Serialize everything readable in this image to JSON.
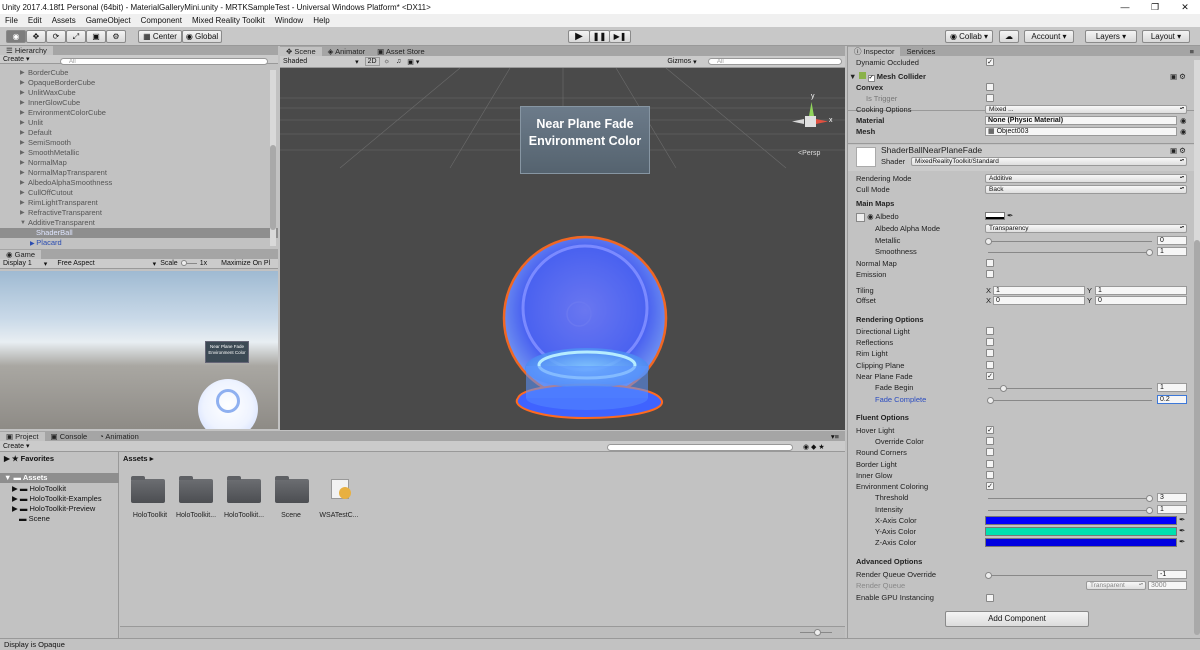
{
  "window_title": "Unity 2017.4.18f1 Personal (64bit) - MaterialGalleryMini.unity - MRTKSampleTest - Universal Windows Platform* <DX11>",
  "menu": [
    "File",
    "Edit",
    "Assets",
    "GameObject",
    "Component",
    "Mixed Reality Toolkit",
    "Window",
    "Help"
  ],
  "toolbar": {
    "center": "Center",
    "global": "Global",
    "collab": "Collab",
    "account": "Account",
    "layers": "Layers",
    "layout": "Layout"
  },
  "hierarchy": {
    "tab": "Hierarchy",
    "create": "Create",
    "search_placeholder": "All",
    "items": [
      "BorderCube",
      "OpaqueBorderCube",
      "UnlitWaxCube",
      "InnerGlowCube",
      "EnvironmentColorCube",
      "Unlit",
      "Default",
      "SemiSmooth",
      "SmoothMetallic",
      "NormalMap",
      "NormalMapTransparent",
      "AlbedoAlphaSmoothness",
      "CullOffCutout",
      "RimLightTransparent",
      "RefractiveTransparent",
      "AdditiveTransparent"
    ],
    "selected": "ShaderBall",
    "next": "Placard"
  },
  "game": {
    "tab": "Game",
    "display": "Display 1",
    "aspect": "Free Aspect",
    "scale_label": "Scale",
    "scale_value": "1x",
    "maximize": "Maximize On Pl",
    "placard": "Near Plane Fade Environment Color"
  },
  "scene": {
    "tab": "Scene",
    "animator": "Animator",
    "asset_store": "Asset Store",
    "shading": "Shaded",
    "mode_2d": "2D",
    "gizmos": "Gizmos",
    "search_placeholder": "All",
    "persp": "Persp",
    "placard": "Near Plane Fade Environment Color",
    "axis_x": "x",
    "axis_y": "y"
  },
  "project": {
    "tab": "Project",
    "console": "Console",
    "animation": "Animation",
    "create": "Create",
    "favorites": "Favorites",
    "assets_root": "Assets",
    "tree": [
      "HoloToolkit",
      "HoloToolkit-Examples",
      "HoloToolkit-Preview",
      "Scene"
    ],
    "breadcrumb": "Assets",
    "items": [
      "HoloToolkit",
      "HoloToolkit...",
      "HoloToolkit...",
      "Scene",
      "WSATestC..."
    ]
  },
  "status": "Display is Opaque",
  "inspector": {
    "tab": "Inspector",
    "services": "Services",
    "dynamic_occluded": "Dynamic Occluded",
    "mesh_collider": "Mesh Collider",
    "convex": "Convex",
    "is_trigger": "Is Trigger",
    "cooking_label": "Cooking Options",
    "cooking_value": "Mixed ...",
    "material_label": "Material",
    "material_value": "None (Physic Material)",
    "mesh_label": "Mesh",
    "mesh_value": "Object003",
    "material_name": "ShaderBallNearPlaneFade",
    "shader_label": "Shader",
    "shader_value": "MixedRealityToolkit/Standard",
    "rendering_mode": "Rendering Mode",
    "rendering_mode_value": "Additive",
    "cull_mode": "Cull Mode",
    "cull_mode_value": "Back",
    "main_maps": "Main Maps",
    "albedo": "Albedo",
    "albedo_alpha_mode": "Albedo Alpha Mode",
    "albedo_alpha_value": "Transparency",
    "metallic": "Metallic",
    "metallic_value": "0",
    "smoothness": "Smoothness",
    "smoothness_value": "1",
    "normal_map": "Normal Map",
    "emission": "Emission",
    "tiling": "Tiling",
    "offset": "Offset",
    "tiling_x": "1",
    "tiling_y": "1",
    "offset_x": "0",
    "offset_y": "0",
    "x": "X",
    "y": "Y",
    "rendering_options": "Rendering Options",
    "directional_light": "Directional Light",
    "reflections": "Reflections",
    "rim_light": "Rim Light",
    "clipping_plane": "Clipping Plane",
    "near_plane_fade": "Near Plane Fade",
    "fade_begin": "Fade Begin",
    "fade_begin_value": "1",
    "fade_complete": "Fade Complete",
    "fade_complete_value": "0.2",
    "fluent_options": "Fluent Options",
    "hover_light": "Hover Light",
    "override_color": "Override Color",
    "round_corners": "Round Corners",
    "border_light": "Border Light",
    "inner_glow": "Inner Glow",
    "environment_coloring": "Environment Coloring",
    "threshold": "Threshold",
    "threshold_value": "3",
    "intensity": "Intensity",
    "intensity_value": "1",
    "x_axis_color": "X-Axis Color",
    "y_axis_color": "Y-Axis Color",
    "z_axis_color": "Z-Axis Color",
    "x_color": "#0000ff",
    "y_color": "#00e0b0",
    "z_color": "#0000e0",
    "advanced_options": "Advanced Options",
    "render_queue_override": "Render Queue Override",
    "render_queue_override_value": "-1",
    "render_queue": "Render Queue",
    "render_queue_type": "Transparent",
    "render_queue_value": "3000",
    "gpu_instancing": "Enable GPU Instancing",
    "add_component": "Add Component"
  }
}
